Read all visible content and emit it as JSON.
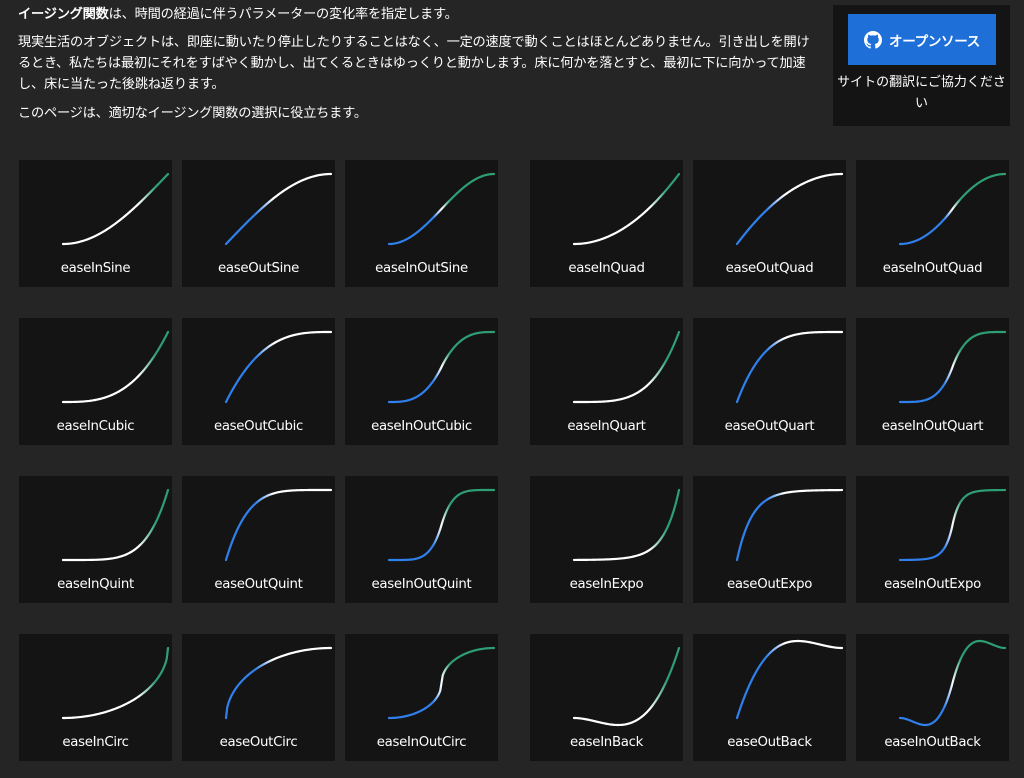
{
  "intro": {
    "lead_bold": "イージング関数",
    "lead_rest": "は、時間の経過に伴うパラメーターの変化率を指定します。",
    "paragraph": "現実生活のオブジェクトは、即座に動いたり停止したりすることはなく、一定の速度で動くことはほとんどありません。引き出しを開けるとき、私たちは最初にそれをすばやく動かし、出てくるときはゆっくりと動かします。床に何かを落とすと、最初に下に向かって加速し、床に当たった後跳ね返ります。",
    "closing": "このページは、適切なイージング関数の選択に役立ちます。"
  },
  "sidebar": {
    "open_source_label": "オープンソース",
    "help_translate": "サイトの翻訳にご協力ください",
    "button_color": "#1f6fd8"
  },
  "colors": {
    "blue": "#2f80ed",
    "white": "#ffffff",
    "green": "#2e9e74",
    "card_bg": "#141414",
    "page_bg": "#252525"
  },
  "easings": [
    {
      "name": "easeInSine",
      "icon": "easeInSine-curve-icon"
    },
    {
      "name": "easeOutSine",
      "icon": "easeOutSine-curve-icon"
    },
    {
      "name": "easeInOutSine",
      "icon": "easeInOutSine-curve-icon"
    },
    {
      "name": "easeInQuad",
      "icon": "easeInQuad-curve-icon"
    },
    {
      "name": "easeOutQuad",
      "icon": "easeOutQuad-curve-icon"
    },
    {
      "name": "easeInOutQuad",
      "icon": "easeInOutQuad-curve-icon"
    },
    {
      "name": "easeInCubic",
      "icon": "easeInCubic-curve-icon"
    },
    {
      "name": "easeOutCubic",
      "icon": "easeOutCubic-curve-icon"
    },
    {
      "name": "easeInOutCubic",
      "icon": "easeInOutCubic-curve-icon"
    },
    {
      "name": "easeInQuart",
      "icon": "easeInQuart-curve-icon"
    },
    {
      "name": "easeOutQuart",
      "icon": "easeOutQuart-curve-icon"
    },
    {
      "name": "easeInOutQuart",
      "icon": "easeInOutQuart-curve-icon"
    },
    {
      "name": "easeInQuint",
      "icon": "easeInQuint-curve-icon"
    },
    {
      "name": "easeOutQuint",
      "icon": "easeOutQuint-curve-icon"
    },
    {
      "name": "easeInOutQuint",
      "icon": "easeInOutQuint-curve-icon"
    },
    {
      "name": "easeInExpo",
      "icon": "easeInExpo-curve-icon"
    },
    {
      "name": "easeOutExpo",
      "icon": "easeOutExpo-curve-icon"
    },
    {
      "name": "easeInOutExpo",
      "icon": "easeInOutExpo-curve-icon"
    },
    {
      "name": "easeInCirc",
      "icon": "easeInCirc-curve-icon"
    },
    {
      "name": "easeOutCirc",
      "icon": "easeOutCirc-curve-icon"
    },
    {
      "name": "easeInOutCirc",
      "icon": "easeInOutCirc-curve-icon"
    },
    {
      "name": "easeInBack",
      "icon": "easeInBack-curve-icon"
    },
    {
      "name": "easeOutBack",
      "icon": "easeOutBack-curve-icon"
    },
    {
      "name": "easeInOutBack",
      "icon": "easeInOutBack-curve-icon"
    }
  ]
}
